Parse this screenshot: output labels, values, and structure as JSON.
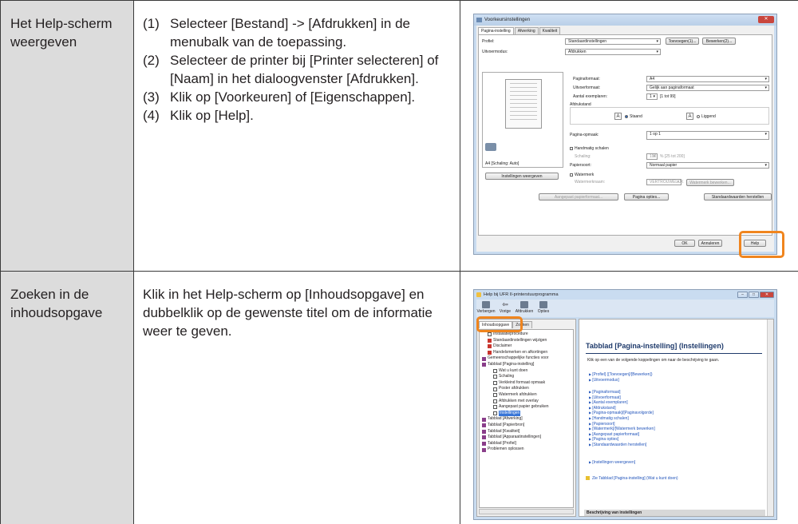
{
  "rows": [
    {
      "heading": "Het Help-scherm weergeven",
      "steps": [
        {
          "num": "(1)",
          "text": "Selecteer [Bestand] -> [Afdrukken] in de menubalk van de toepassing."
        },
        {
          "num": "(2)",
          "text": "Selecteer de printer bij [Printer selecteren] of [Naam] in het dialoogvenster [Afdrukken]."
        },
        {
          "num": "(3)",
          "text": "Klik op [Voorkeuren] of [Eigenschappen]."
        },
        {
          "num": "(4)",
          "text": "Klik op [Help]."
        }
      ]
    },
    {
      "heading": "Zoeken in de inhoudsopgave",
      "text": "Klik in het Help-scherm op [Inhoudsopgave] en dubbelklik op de gewenste titel om de informatie weer te geven."
    }
  ],
  "dialog": {
    "title": "Voorkeursinstellingen",
    "close": "✕",
    "tabs": [
      "Pagina-instelling",
      "Afwerking",
      "Kwaliteit"
    ],
    "profile_label": "Profiel:",
    "profile_value": "Standaardinstellingen",
    "add_btn": "Toevoegen(1)...",
    "edit_btn": "Bewerken(2)...",
    "output_label": "Uitvoermodus:",
    "output_value": "Afdrukken",
    "page_size_label": "Paginaformaat:",
    "page_size_value": "A4",
    "output_size_label": "Uitvoerformaat:",
    "output_size_value": "Gelijk aan paginaformaat",
    "copies_label": "Aantal exemplaren:",
    "copies_value": "1",
    "copies_range": "[1 tot 99]",
    "orientation_label": "Afdrukstand",
    "portrait": "Staand",
    "landscape": "Liggend",
    "layout_label": "Pagina-opmaak:",
    "layout_value": "1 op 1",
    "manual_scale": "Handmatig schalen",
    "scale_label": "Schaling:",
    "scale_value": "100",
    "scale_range": "% [25 tot 200]",
    "paper_label": "Papiersoort:",
    "paper_value": "Normaal papier",
    "watermark": "Watermerk",
    "watermark_name_label": "Watermerknaam:",
    "watermark_value": "VERTROUWELIJK",
    "watermark_edit": "Watermerk bewerken...",
    "preview_label": "A4 [Schaling: Auto]",
    "show_settings": "Instellingen weergeven",
    "custom_paper": "Aangepast papierformaat...",
    "page_options": "Pagina opties...",
    "restore_defaults": "Standaardwaarden herstellen",
    "ok": "OK",
    "cancel": "Annuleren",
    "help": "Help"
  },
  "help_window": {
    "title": "Help bij UFR II-printerstuurprogramma",
    "toolbar": [
      "Verbergen",
      "Vorige",
      "Afdrukken",
      "Opties"
    ],
    "tabs": [
      "Inhoudsopgave",
      "Zoeken"
    ],
    "tree": [
      {
        "label": "Installatieprocedure",
        "icon": "doc",
        "indent": 1
      },
      {
        "label": "Standaardinstellingen wijzigen",
        "icon": "red",
        "indent": 1
      },
      {
        "label": "Disclaimer",
        "icon": "red",
        "indent": 1
      },
      {
        "label": "Handelsmerken en afkortingen",
        "icon": "red",
        "indent": 1
      },
      {
        "label": "Gemeenschappelijke functies voor",
        "icon": "book",
        "indent": 0
      },
      {
        "label": "Tabblad [Pagina-instelling]",
        "icon": "book",
        "indent": 0
      },
      {
        "label": "Wat u kunt doen",
        "icon": "doc",
        "indent": 2
      },
      {
        "label": "Schaling",
        "icon": "doc",
        "indent": 2
      },
      {
        "label": "Verkleind formaat opmaak",
        "icon": "doc",
        "indent": 2
      },
      {
        "label": "Poster afdrukken",
        "icon": "doc",
        "indent": 2
      },
      {
        "label": "Watermerk afdrukken",
        "icon": "doc",
        "indent": 2
      },
      {
        "label": "Afdrukken met overlay",
        "icon": "doc",
        "indent": 2
      },
      {
        "label": "Aangepast papier gebruiken",
        "icon": "doc",
        "indent": 2
      },
      {
        "label": "Instellingen",
        "icon": "doc",
        "indent": 2,
        "selected": true
      },
      {
        "label": "Tabblad [Afwerking]",
        "icon": "book",
        "indent": 0
      },
      {
        "label": "Tabblad [Papierbron]",
        "icon": "book",
        "indent": 0
      },
      {
        "label": "Tabblad [Kwaliteit]",
        "icon": "book",
        "indent": 0
      },
      {
        "label": "Tabblad [Apparaatinstellingen]",
        "icon": "book",
        "indent": 0
      },
      {
        "label": "Tabblad [Profiel]",
        "icon": "book",
        "indent": 0
      },
      {
        "label": "Problemen oplossen",
        "icon": "book",
        "indent": 0
      }
    ],
    "heading": "Tabblad [Pagina-instelling] (Instellingen)",
    "intro": "Klik op een van de volgende koppelingen om naar de beschrijving te gaan.",
    "links_a": [
      "[Profiel] ([Toevoegen]/[Bewerken])",
      "[Uitvoermodus]"
    ],
    "links_b": [
      "[Paginaformaat]",
      "[Uitvoerformaat]",
      "[Aantal exemplaren]",
      "[Afdrukstand]",
      "[Pagina-opmaak]/[Paginavolgorde]",
      "[Handmatig schalen]",
      "[Papiersoort]",
      "[Watermerk]/[Watermerk bewerken]",
      "[Aangepast papierformaat]",
      "[Pagina opties]",
      "[Standaardwaarden herstellen]"
    ],
    "links_c": [
      "[Instellingen weergeven]"
    ],
    "see_also": "Zie Tabblad [Pagina-instelling] (Wat u kunt doen)",
    "bottom_heading": "Beschrijving van instellingen"
  },
  "colors": {
    "highlight": "#f0851e",
    "label_bg": "#dcdcdc"
  }
}
